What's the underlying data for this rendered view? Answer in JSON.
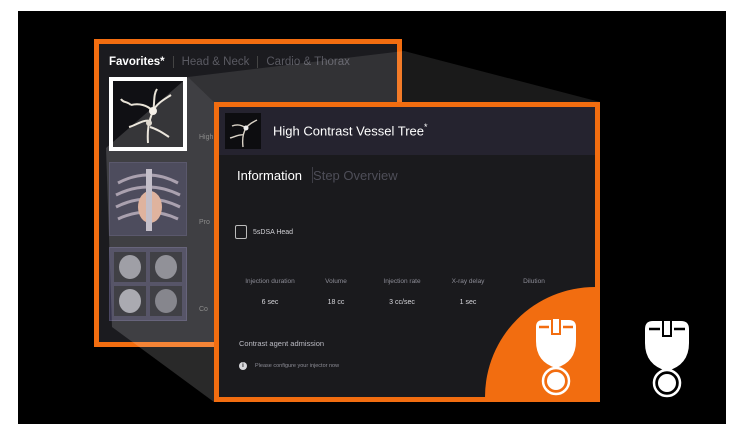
{
  "back_panel": {
    "tabs": [
      {
        "label": "Favorites*",
        "active": true
      },
      {
        "label": "Head & Neck",
        "active": false
      },
      {
        "label": "Cardio & Thorax",
        "active": false
      }
    ],
    "partial_labels": [
      "High",
      "Pro",
      "Co"
    ]
  },
  "front_panel": {
    "title": "High Contrast Vessel Tree",
    "title_mark": "*",
    "tabs": [
      {
        "label": "Information",
        "active": true
      },
      {
        "label": "Step Overview",
        "active": false
      }
    ],
    "protocol_name": "5sDSA Head",
    "params": [
      {
        "label": "Injection duration",
        "value": "6 sec"
      },
      {
        "label": "Volume",
        "value": "18 cc"
      },
      {
        "label": "Injection rate",
        "value": "3 cc/sec"
      },
      {
        "label": "X-ray delay",
        "value": "1 sec"
      },
      {
        "label": "Dilution",
        "value": ""
      }
    ],
    "contrast_label": "Contrast agent admission",
    "info_text": "Please configure your injector now",
    "info_icon": "info-icon"
  },
  "colors": {
    "accent": "#f26d10",
    "background": "#000000",
    "panel": "#1a1a1d"
  },
  "icons": [
    "injector-icon",
    "info-icon",
    "protocol-icon"
  ]
}
